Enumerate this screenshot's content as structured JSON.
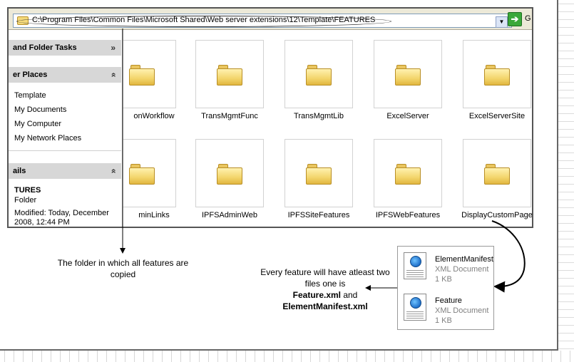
{
  "address_bar": {
    "path": "C:\\Program Files\\Common Files\\Microsoft Shared\\Web server extensions\\12\\Template\\FEATURES",
    "go_label": "G"
  },
  "task_pane": {
    "file_folder_tasks": {
      "title": "and Folder Tasks"
    },
    "other_places": {
      "title": "er Places",
      "items": [
        "Template",
        "My Documents",
        "My Computer",
        "My Network Places"
      ]
    },
    "details": {
      "title": "ails",
      "name": "TURES",
      "type": "Folder",
      "modified_line1": "Modified: Today, December",
      "modified_line2": "2008, 12:44 PM"
    }
  },
  "folders": [
    "onWorkflow",
    "TransMgmtFunc",
    "TransMgmtLib",
    "ExcelServer",
    "ExcelServerSite",
    "minLinks",
    "IPFSAdminWeb",
    "IPFSSiteFeatures",
    "IPFSWebFeatures",
    "DisplayCustomPage"
  ],
  "annotations": {
    "folder_note": [
      "The folder in which all features are",
      "copied"
    ],
    "feature_note": {
      "line1": "Every feature will have atleast two",
      "line2": "files one is",
      "line3": "Feature.xml",
      "line3_suffix": " and",
      "line4": "ElementManifest.xml"
    }
  },
  "feature_files": [
    {
      "name": "ElementManifest",
      "type": "XML Document",
      "size": "1 KB"
    },
    {
      "name": "Feature",
      "type": "XML Document",
      "size": "1 KB"
    }
  ],
  "icons": {
    "folder": "folder-icon",
    "xml": "xml-document-icon",
    "go": "go-arrow-icon"
  }
}
